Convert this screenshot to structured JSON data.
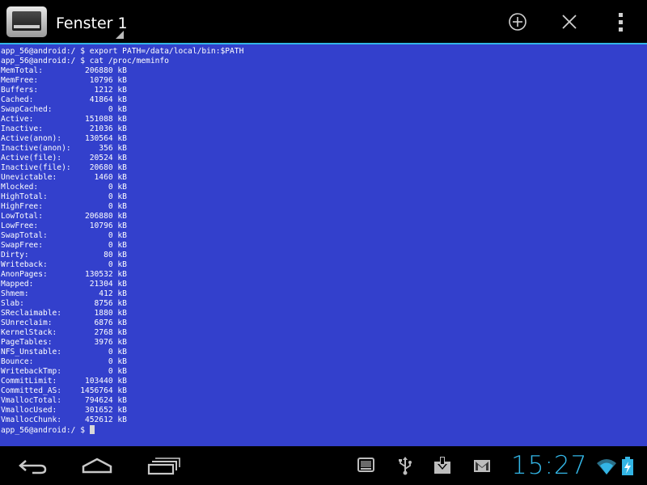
{
  "action_bar": {
    "title": "Fenster 1",
    "icons": [
      "terminal-app-icon",
      "add-window-icon",
      "close-window-icon",
      "overflow-menu-icon"
    ],
    "accent_color": "#33b5e5"
  },
  "terminal": {
    "background_color": "#3340cc",
    "text_color": "#ffffff",
    "lines": [
      "app_56@android:/ $ export PATH=/data/local/bin:$PATH",
      "app_56@android:/ $ cat /proc/meminfo",
      "MemTotal:         206880 kB",
      "MemFree:           10796 kB",
      "Buffers:            1212 kB",
      "Cached:            41864 kB",
      "SwapCached:            0 kB",
      "Active:           151088 kB",
      "Inactive:          21036 kB",
      "Active(anon):     130564 kB",
      "Inactive(anon):      356 kB",
      "Active(file):      20524 kB",
      "Inactive(file):    20680 kB",
      "Unevictable:        1460 kB",
      "Mlocked:               0 kB",
      "HighTotal:             0 kB",
      "HighFree:              0 kB",
      "LowTotal:         206880 kB",
      "LowFree:           10796 kB",
      "SwapTotal:             0 kB",
      "SwapFree:              0 kB",
      "Dirty:                80 kB",
      "Writeback:             0 kB",
      "AnonPages:        130532 kB",
      "Mapped:            21304 kB",
      "Shmem:               412 kB",
      "Slab:               8756 kB",
      "SReclaimable:       1880 kB",
      "SUnreclaim:         6876 kB",
      "KernelStack:        2768 kB",
      "PageTables:         3976 kB",
      "NFS_Unstable:          0 kB",
      "Bounce:                0 kB",
      "WritebackTmp:          0 kB",
      "CommitLimit:      103440 kB",
      "Committed_AS:    1456764 kB",
      "VmallocTotal:     794624 kB",
      "VmallocUsed:      301652 kB",
      "VmallocChunk:     452612 kB"
    ],
    "prompt": "app_56@android:/ $ "
  },
  "system_bar": {
    "nav_icons": [
      "back-icon",
      "home-icon",
      "recent-apps-icon"
    ],
    "status_icons": [
      "terminal-notification-icon",
      "usb-icon",
      "download-icon",
      "gmail-icon",
      "wifi-icon",
      "battery-charging-icon"
    ],
    "clock": "15:27",
    "clock_color": "#33b5e5"
  }
}
